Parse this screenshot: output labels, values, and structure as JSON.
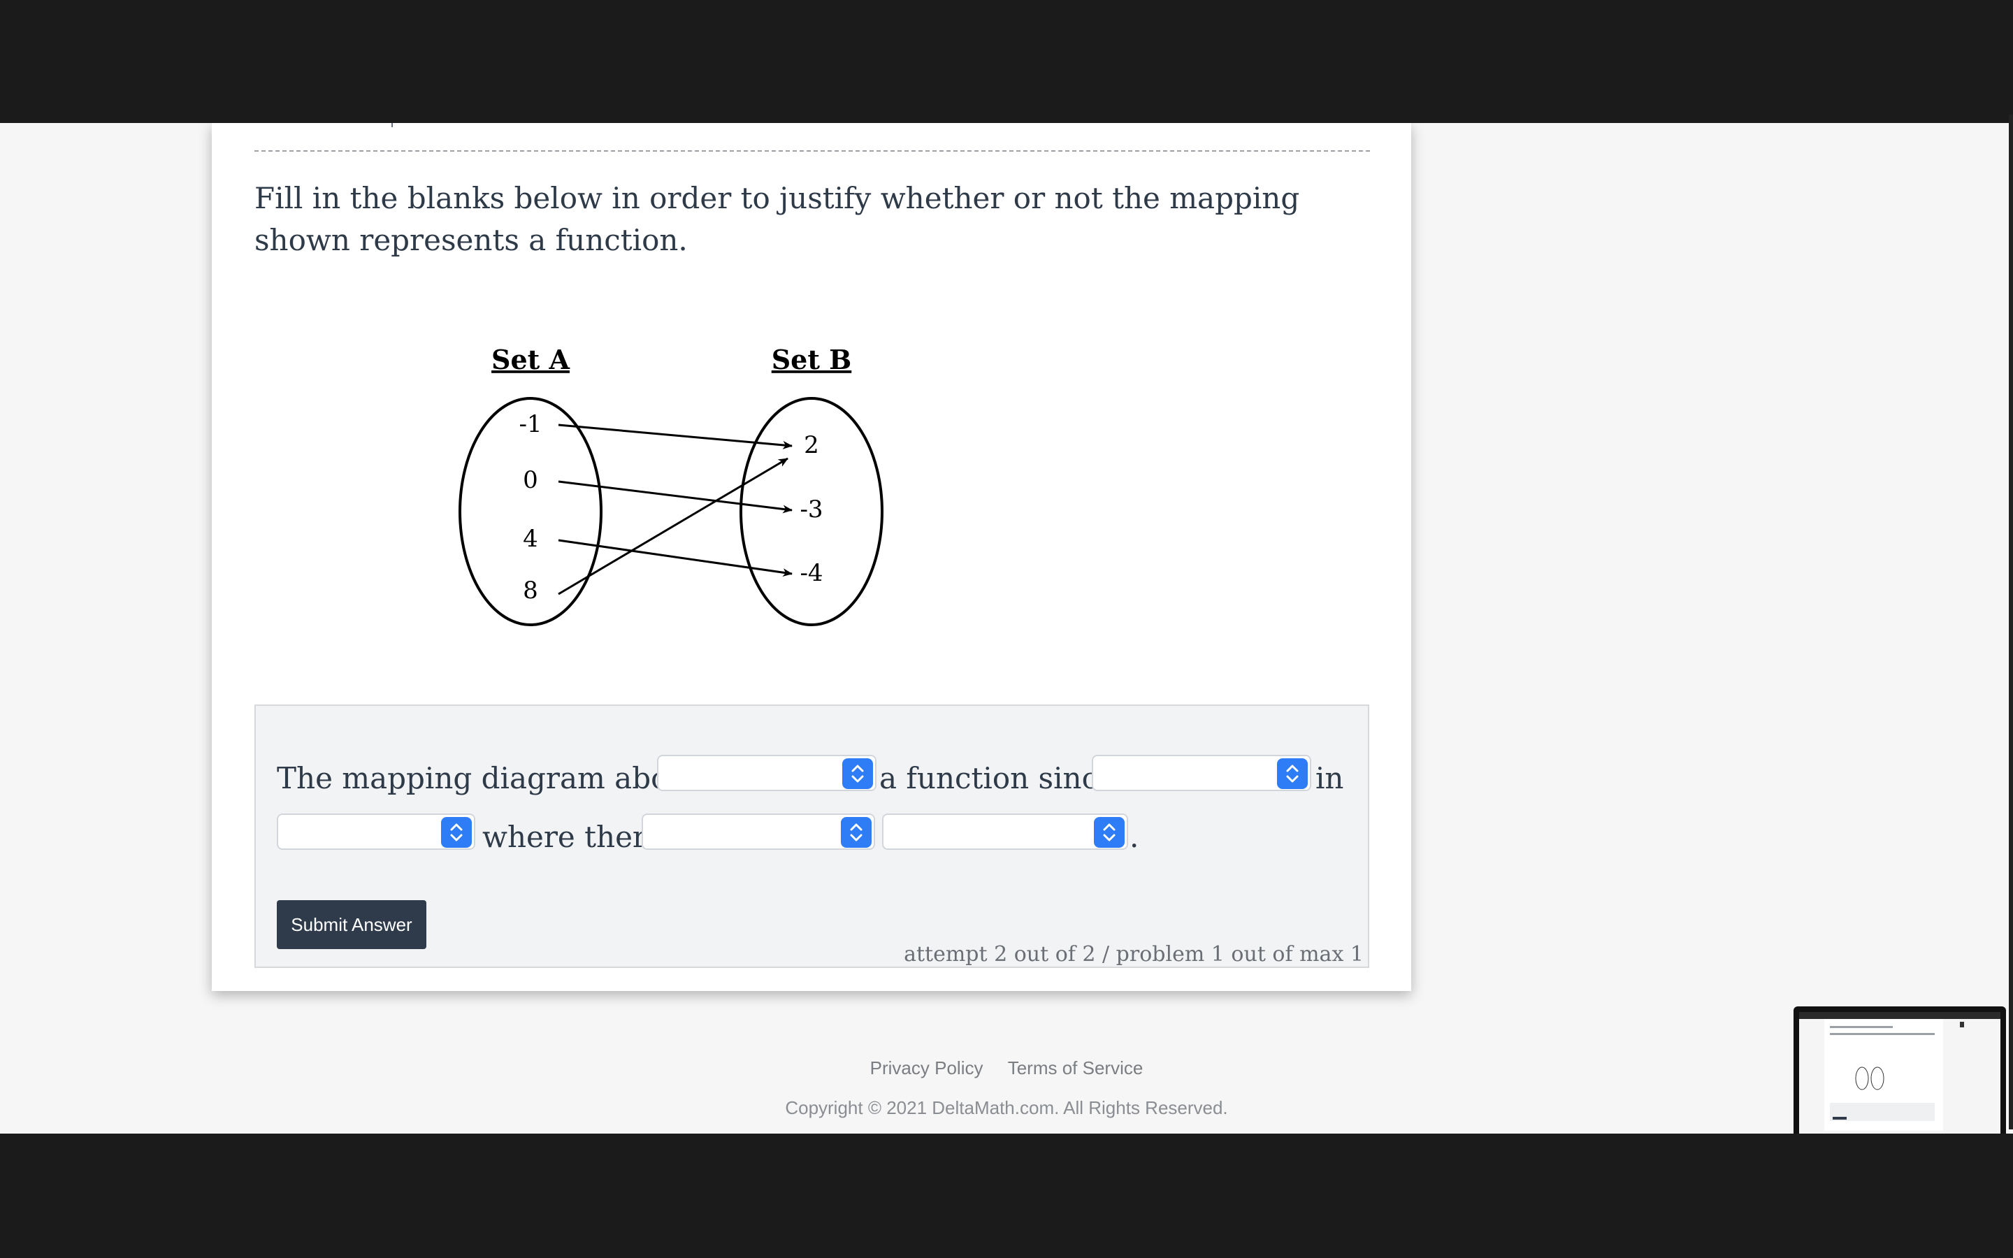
{
  "problem": {
    "instructions": "Fill in the blanks below in order to justify whether or not the mapping shown represents a function."
  },
  "diagram": {
    "set_a_label": "Set A",
    "set_b_label": "Set B",
    "set_a": [
      "-1",
      "0",
      "4",
      "8"
    ],
    "set_b": [
      "2",
      "-3",
      "-4"
    ],
    "mappings": [
      [
        "-1",
        "2"
      ],
      [
        "0",
        "-3"
      ],
      [
        "4",
        "-4"
      ],
      [
        "8",
        "2"
      ]
    ]
  },
  "answer": {
    "text_1": "The mapping diagram above",
    "text_2": "a function since",
    "text_3": "in",
    "text_4": "where there",
    "text_5": ".",
    "dropdowns": [
      "",
      "",
      "",
      "",
      ""
    ],
    "submit_label": "Submit Answer",
    "attempt_text": "attempt 2 out of 2 / problem 1 out of max 1"
  },
  "footer": {
    "privacy": "Privacy Policy",
    "terms": "Terms of Service",
    "copyright": "Copyright © 2021 DeltaMath.com. All Rights Reserved."
  },
  "colors": {
    "dropdown_accent": "#2f7df6",
    "submit_button": "#2f3b4b",
    "text": "#2e3a48"
  }
}
